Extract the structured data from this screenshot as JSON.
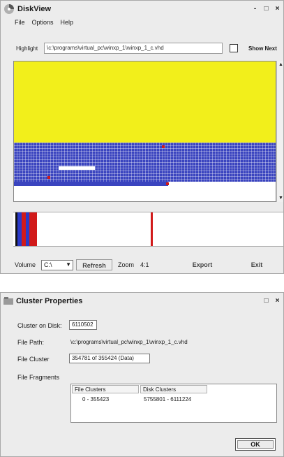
{
  "diskview": {
    "title": "DiskView",
    "window_controls": [
      "-",
      "□",
      "×"
    ],
    "menu": [
      "File",
      "Options",
      "Help"
    ],
    "highlight_label": "Highlight",
    "highlight_value": "\\c:\\programs\\virtual_pc\\winxp_1\\winxp_1_c.vhd",
    "show_next_label": "Show Next",
    "volume_label": "Volume",
    "volume_value": "C:\\",
    "refresh_label": "Refresh",
    "zoom_label": "Zoom",
    "zoom_value": "4:1",
    "export_label": "Export",
    "exit_label": "Exit",
    "colors": {
      "yellow": "#f2ef1b",
      "blue": "#3a44bf",
      "red": "#d11a1a"
    }
  },
  "cluster": {
    "title": "Cluster Properties",
    "window_controls": [
      "□",
      "×"
    ],
    "cluster_on_disk_label": "Cluster on Disk:",
    "cluster_on_disk_value": "6110502",
    "file_path_label": "File Path:",
    "file_path_value": "\\c:\\programs\\virtual_pc\\winxp_1\\winxp_1_c.vhd",
    "file_cluster_label": "File Cluster",
    "file_cluster_value": "354781 of 355424 (Data)",
    "file_fragments_label": "File Fragments",
    "fragments_headers": [
      "File Clusters",
      "Disk Clusters"
    ],
    "fragments_rows": [
      {
        "file": "0 - 355423",
        "disk": "5755801 - 6111224"
      }
    ],
    "ok_label": "OK"
  }
}
